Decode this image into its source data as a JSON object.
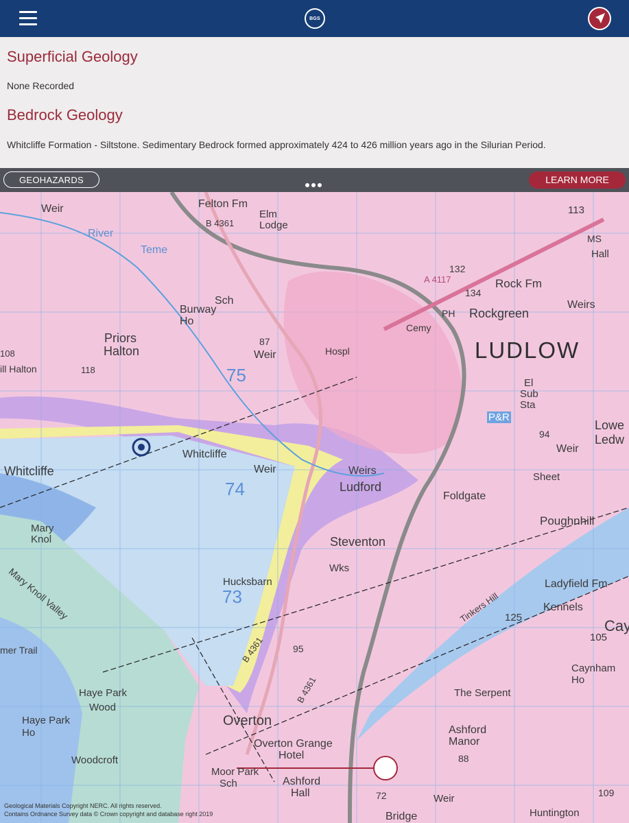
{
  "header": {
    "menu_icon": "hamburger-menu-icon",
    "logo_text": "BGS",
    "locate_icon": "navigation-arrow-icon",
    "colors": {
      "bar": "#163d75",
      "accent": "#a5283a"
    }
  },
  "info_panel": {
    "superficial_title": "Superficial Geology",
    "superficial_value": "None Recorded",
    "bedrock_title": "Bedrock Geology",
    "bedrock_value": "Whitcliffe Formation - Siltstone.  Sedimentary Bedrock formed approximately 424 to 426 million years ago in the Silurian Period."
  },
  "toolbar": {
    "geohazards_label": "GEOHAZARDS",
    "more_icon": "more-dots-icon",
    "learn_more_label": "LEARN MORE"
  },
  "map": {
    "labels": {
      "weir_nw": "Weir",
      "felton": "Felton Fm",
      "elm_lodge": "Elm Lodge",
      "river": "River",
      "teme": "Teme",
      "b4361_north": "B 4361",
      "sch": "Sch",
      "burway": "Burway",
      "ho": "Ho",
      "priors": "Priors",
      "halton": "Halton",
      "n108": "108",
      "n118": "118",
      "hill_halton": "ill Halton",
      "n87": "87",
      "weir_mid": "Weir",
      "hospl": "Hospl",
      "cemy": "Cemy",
      "rock_fm": "Rock Fm",
      "rockgreen": "Rockgreen",
      "ph": "PH",
      "n132": "132",
      "n134": "134",
      "a4117": "A 4117",
      "n113": "113",
      "ms": "MS",
      "hall": "Hall",
      "weirs_ne": "Weirs",
      "ludlow": "LUDLOW",
      "grid75": "75",
      "el": "El",
      "sub": "Sub",
      "sta": "Sta",
      "pr": "P&R",
      "n94": "94",
      "lowe": "Lowe",
      "ledw": "Ledw",
      "weir_e": "Weir",
      "sheet": "Sheet",
      "whitcliffe_label": "Whitcliffe",
      "whitcliffe_w": "Whitcliffe",
      "weir_lower": "Weir",
      "grid74": "74",
      "weirs_mid": "Weirs",
      "ludford": "Ludford",
      "foldgate": "Foldgate",
      "poughnhill": "Poughnhill",
      "mary": "Mary",
      "knol": "Knol",
      "steventon": "Steventon",
      "wks": "Wks",
      "hucksbarn": "Hucksbarn",
      "grid73": "73",
      "ladyfield": "Ladyfield Fm",
      "kennels": "Kennels",
      "n125": "125",
      "cay": "Cay",
      "n105": "105",
      "tinkers": "Tinkers Hill",
      "mary_knoll_valley": "Mary Knoll Valley",
      "b4361_south": "B 4361",
      "n95": "95",
      "mer_trail": "mer Trail",
      "caynham": "Caynham",
      "ho2": "Ho",
      "the_serpent": "The Serpent",
      "haye_park": "Haye Park",
      "wood": "Wood",
      "overton": "Overton",
      "b4361_se": "B 4361",
      "haye_park_ho": "Haye Park",
      "ho3": "Ho",
      "overton_grange": "Overton Grange",
      "hotel": "Hotel",
      "ashford_manor": "Ashford",
      "manor": "Manor",
      "n88": "88",
      "woodcroft": "Woodcroft",
      "moor_park": "Moor Park",
      "sch2": "Sch",
      "ashford_hall": "Ashford",
      "hall2": "Hall",
      "n72": "72",
      "weir_s": "Weir",
      "bridge": "Bridge",
      "huntington": "Huntington",
      "n109": "109"
    },
    "copyright_1": "Geological Materials Copyright NERC. All rights reserved.",
    "copyright_2": "Contains Ordnance Survey data © Crown copyright and database right 2019",
    "location_marker_icon": "location-target-icon",
    "slider_handle_icon": "slider-handle-icon",
    "colors": {
      "bedrock_pink": "#f2c7de",
      "purple": "#c9a6e6",
      "yellow": "#f2ee9b",
      "light_blue": "#c6ddf2",
      "blue": "#8fb5e8",
      "green": "#b7dcd3"
    }
  }
}
